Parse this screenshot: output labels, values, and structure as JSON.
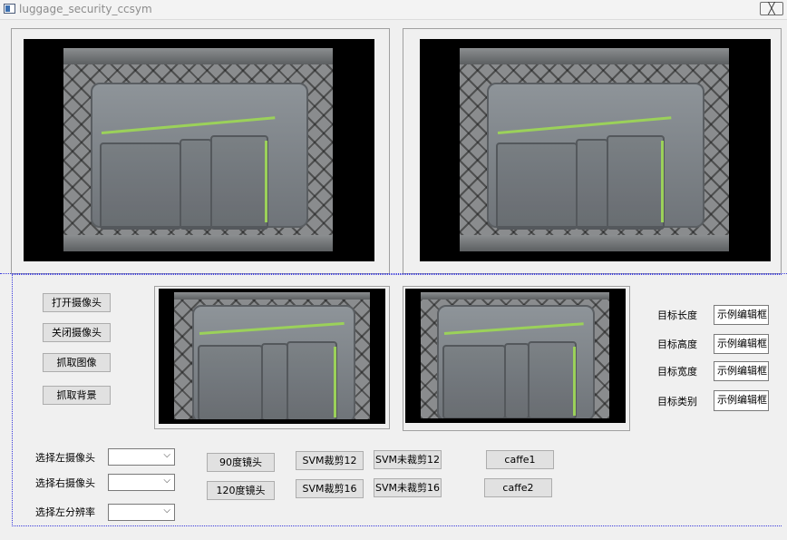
{
  "window": {
    "title": "luggage_security_ccsym",
    "close_label": "╳"
  },
  "buttons": {
    "open_camera": "打开摄像头",
    "close_camera": "关闭摄像头",
    "capture_image": "抓取图像",
    "capture_background": "抓取背景",
    "lens_90": "90度镜头",
    "lens_120": "120度镜头",
    "svm_crop_12": "SVM裁剪12",
    "svm_nocrop_12": "SVM未裁剪12",
    "svm_crop_16": "SVM裁剪16",
    "svm_nocrop_16": "SVM未裁剪16",
    "caffe1": "caffe1",
    "caffe2": "caffe2"
  },
  "selectors": {
    "left_camera_label": "选择左摄像头",
    "right_camera_label": "选择右摄像头",
    "left_resolution_label": "选择左分辨率",
    "left_camera_value": "",
    "right_camera_value": "",
    "left_resolution_value": ""
  },
  "targets": {
    "length_label": "目标长度",
    "height_label": "目标高度",
    "width_label": "目标宽度",
    "class_label": "目标类别",
    "length_value": "示例编辑框",
    "height_value": "示例编辑框",
    "width_value": "示例编辑框",
    "class_value": "示例编辑框"
  }
}
